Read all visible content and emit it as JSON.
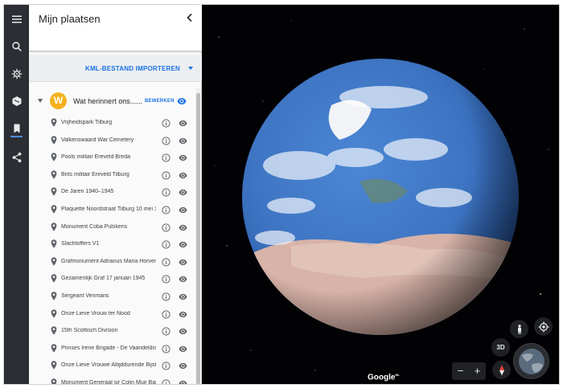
{
  "panel": {
    "title": "Mijn plaatsen",
    "import_label": "KML-BESTAND IMPORTEREN",
    "folder": {
      "initial": "W",
      "name": "Wat herinnert ons......",
      "edit_label": "BEWERKEN"
    },
    "items": [
      "Vrijheidspark Tilburg",
      "Valkenswaard War Cemetery",
      "Pools militair Ereveld Breda",
      "Brits militair Ereveld Tilburg",
      "De Jaren 1940–1945",
      "Plaquette Noordstraat Tilburg 10 mei 1...",
      "Monument Coba Pulskens",
      "Slachtoffers V1",
      "Grafmonument Adrianus Maria Horvers",
      "Gezamenlijk Graf 17 januari 1945",
      "Sergeant Venmans",
      "Onze Lieve Vrouw ter Nood",
      "15th Scottisch Division",
      "Prinses Irene Brigade - De Vaandeldrager",
      "Onze Lieve Vrouwe Altijddurende Bijsta...",
      "Monument Generaal sir Colin Muir Barb..."
    ]
  },
  "map": {
    "btn_3d": "3D",
    "attribution": "Google",
    "attribution_sup": "NL"
  },
  "colors": {
    "rail": "#2b2e32",
    "accent": "#1a73e8",
    "avatar": "#f5b21e"
  }
}
